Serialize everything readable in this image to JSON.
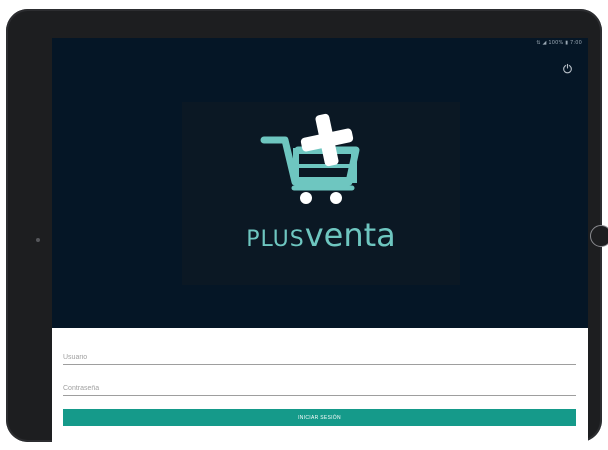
{
  "status_bar": {
    "text": "⇅ ◢ 100% ▮ 7:00"
  },
  "brand": {
    "name_prefix": "PLUS",
    "name_suffix": "venta",
    "color": "#6ec6c0",
    "logo_icon": "cart-plus-icon"
  },
  "toolbar": {
    "power_icon": "power-icon"
  },
  "login": {
    "username_placeholder": "Usuario",
    "password_placeholder": "Contraseña",
    "submit_label": "INICIAR SESIÓN"
  },
  "colors": {
    "screen_bg": "#051626",
    "logo_bg": "#0b1824",
    "accent": "#159a8a"
  }
}
